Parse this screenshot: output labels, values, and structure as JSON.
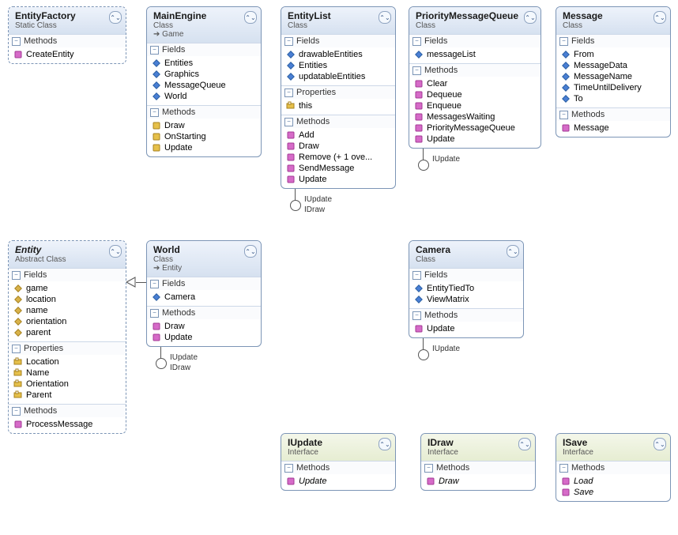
{
  "boxes": {
    "entityFactory": {
      "title": "EntityFactory",
      "subtitle": "Static Class",
      "sections": [
        {
          "name": "Methods",
          "members": [
            {
              "icon": "method-pub",
              "text": "CreateEntity"
            }
          ]
        }
      ]
    },
    "mainEngine": {
      "title": "MainEngine",
      "subtitle": "Class",
      "implements_arrow": "Game",
      "sections": [
        {
          "name": "Fields",
          "members": [
            {
              "icon": "field",
              "text": "Entities"
            },
            {
              "icon": "field",
              "text": "Graphics"
            },
            {
              "icon": "field",
              "text": "MessageQueue"
            },
            {
              "icon": "field",
              "text": "World"
            }
          ]
        },
        {
          "name": "Methods",
          "members": [
            {
              "icon": "method-prot",
              "text": "Draw"
            },
            {
              "icon": "method-prot",
              "text": "OnStarting"
            },
            {
              "icon": "method-prot",
              "text": "Update"
            }
          ]
        }
      ]
    },
    "entityList": {
      "title": "EntityList",
      "subtitle": "Class",
      "sections": [
        {
          "name": "Fields",
          "members": [
            {
              "icon": "field",
              "text": "drawableEntities"
            },
            {
              "icon": "field",
              "text": "Entities"
            },
            {
              "icon": "field",
              "text": "updatableEntities"
            }
          ]
        },
        {
          "name": "Properties",
          "members": [
            {
              "icon": "prop",
              "text": "this"
            }
          ]
        },
        {
          "name": "Methods",
          "members": [
            {
              "icon": "method-pub",
              "text": "Add"
            },
            {
              "icon": "method-pub",
              "text": "Draw"
            },
            {
              "icon": "method-pub",
              "text": "Remove (+ 1 ove..."
            },
            {
              "icon": "method-pub",
              "text": "SendMessage"
            },
            {
              "icon": "method-pub",
              "text": "Update"
            }
          ]
        }
      ],
      "implements": [
        "IUpdate",
        "IDraw"
      ]
    },
    "priorityQ": {
      "title": "PriorityMessageQueue",
      "subtitle": "Class",
      "sections": [
        {
          "name": "Fields",
          "members": [
            {
              "icon": "field",
              "text": "messageList"
            }
          ]
        },
        {
          "name": "Methods",
          "members": [
            {
              "icon": "method-pub",
              "text": "Clear"
            },
            {
              "icon": "method-pub",
              "text": "Dequeue"
            },
            {
              "icon": "method-pub",
              "text": "Enqueue"
            },
            {
              "icon": "method-pub",
              "text": "MessagesWaiting"
            },
            {
              "icon": "method-pub",
              "text": "PriorityMessageQueue"
            },
            {
              "icon": "method-pub",
              "text": "Update"
            }
          ]
        }
      ],
      "implements": [
        "IUpdate"
      ]
    },
    "message": {
      "title": "Message",
      "subtitle": "Class",
      "sections": [
        {
          "name": "Fields",
          "members": [
            {
              "icon": "field",
              "text": "From"
            },
            {
              "icon": "field",
              "text": "MessageData"
            },
            {
              "icon": "field",
              "text": "MessageName"
            },
            {
              "icon": "field",
              "text": "TimeUntilDelivery"
            },
            {
              "icon": "field",
              "text": "To"
            }
          ]
        },
        {
          "name": "Methods",
          "members": [
            {
              "icon": "method-pub",
              "text": "Message"
            }
          ]
        }
      ]
    },
    "entity": {
      "title": "Entity",
      "subtitle": "Abstract Class",
      "titleItalic": true,
      "sections": [
        {
          "name": "Fields",
          "members": [
            {
              "icon": "field-prot",
              "text": "game"
            },
            {
              "icon": "field-prot",
              "text": "location"
            },
            {
              "icon": "field-prot",
              "text": "name"
            },
            {
              "icon": "field-prot",
              "text": "orientation"
            },
            {
              "icon": "field-prot",
              "text": "parent"
            }
          ]
        },
        {
          "name": "Properties",
          "members": [
            {
              "icon": "prop",
              "text": "Location"
            },
            {
              "icon": "prop",
              "text": "Name"
            },
            {
              "icon": "prop",
              "text": "Orientation"
            },
            {
              "icon": "prop",
              "text": "Parent"
            }
          ]
        },
        {
          "name": "Methods",
          "members": [
            {
              "icon": "method-pub",
              "text": "ProcessMessage"
            }
          ]
        }
      ]
    },
    "world": {
      "title": "World",
      "subtitle": "Class",
      "implements_arrow": "Entity",
      "sections": [
        {
          "name": "Fields",
          "members": [
            {
              "icon": "field",
              "text": "Camera"
            }
          ]
        },
        {
          "name": "Methods",
          "members": [
            {
              "icon": "method-pub",
              "text": "Draw"
            },
            {
              "icon": "method-pub",
              "text": "Update"
            }
          ]
        }
      ],
      "implements": [
        "IUpdate",
        "IDraw"
      ]
    },
    "camera": {
      "title": "Camera",
      "subtitle": "Class",
      "sections": [
        {
          "name": "Fields",
          "members": [
            {
              "icon": "field",
              "text": "EntityTiedTo"
            },
            {
              "icon": "field",
              "text": "ViewMatrix"
            }
          ]
        },
        {
          "name": "Methods",
          "members": [
            {
              "icon": "method-pub",
              "text": "Update"
            }
          ]
        }
      ],
      "implements": [
        "IUpdate"
      ]
    },
    "iupdate": {
      "title": "IUpdate",
      "subtitle": "Interface",
      "interface": true,
      "sections": [
        {
          "name": "Methods",
          "members": [
            {
              "icon": "method-pub",
              "text": "Update",
              "italic": true
            }
          ]
        }
      ]
    },
    "idraw": {
      "title": "IDraw",
      "subtitle": "Interface",
      "interface": true,
      "sections": [
        {
          "name": "Methods",
          "members": [
            {
              "icon": "method-pub",
              "text": "Draw",
              "italic": true
            }
          ]
        }
      ]
    },
    "isave": {
      "title": "ISave",
      "subtitle": "Interface",
      "interface": true,
      "sections": [
        {
          "name": "Methods",
          "members": [
            {
              "icon": "method-pub",
              "text": "Load",
              "italic": true
            },
            {
              "icon": "method-pub",
              "text": "Save",
              "italic": true
            }
          ]
        }
      ]
    }
  },
  "labels": {
    "fields": "Fields",
    "methods": "Methods",
    "properties": "Properties"
  }
}
